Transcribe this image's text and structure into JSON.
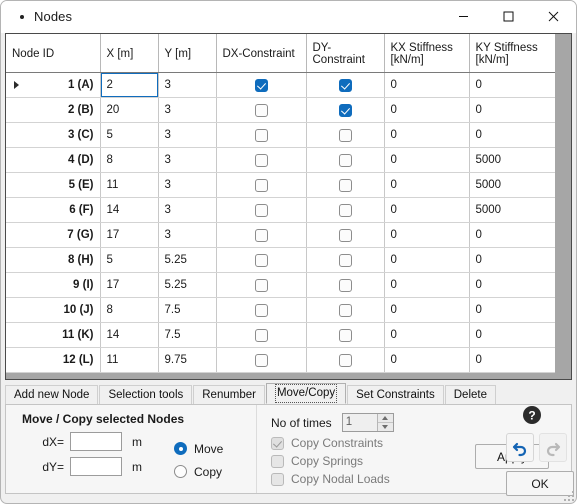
{
  "window": {
    "title": "Nodes",
    "icon": "bullet-icon",
    "controls": {
      "minimize": "minimize-icon",
      "maximize": "maximize-icon",
      "close": "close-icon"
    }
  },
  "grid": {
    "columns": [
      {
        "key": "id",
        "label": "Node ID"
      },
      {
        "key": "x",
        "label": "X [m]"
      },
      {
        "key": "y",
        "label": "Y [m]"
      },
      {
        "key": "dx",
        "label": "DX-Constraint"
      },
      {
        "key": "dy",
        "label": "DY-Constraint"
      },
      {
        "key": "kx",
        "label": "KX Stiffness\n[kN/m]",
        "line1": "KX Stiffness",
        "line2": "[kN/m]"
      },
      {
        "key": "ky",
        "label": "KY Stiffness\n[kN/m]",
        "line1": "KY Stiffness",
        "line2": "[kN/m]"
      }
    ],
    "selected_cell": {
      "row": 0,
      "column": "x"
    },
    "current_row_indicator": 0,
    "rows": [
      {
        "id": "1 (A)",
        "x": "2",
        "y": "3",
        "dx": true,
        "dy": true,
        "kx": "0",
        "ky": "0"
      },
      {
        "id": "2 (B)",
        "x": "20",
        "y": "3",
        "dx": false,
        "dy": true,
        "kx": "0",
        "ky": "0"
      },
      {
        "id": "3 (C)",
        "x": "5",
        "y": "3",
        "dx": false,
        "dy": false,
        "kx": "0",
        "ky": "0"
      },
      {
        "id": "4 (D)",
        "x": "8",
        "y": "3",
        "dx": false,
        "dy": false,
        "kx": "0",
        "ky": "5000"
      },
      {
        "id": "5 (E)",
        "x": "11",
        "y": "3",
        "dx": false,
        "dy": false,
        "kx": "0",
        "ky": "5000"
      },
      {
        "id": "6 (F)",
        "x": "14",
        "y": "3",
        "dx": false,
        "dy": false,
        "kx": "0",
        "ky": "5000"
      },
      {
        "id": "7 (G)",
        "x": "17",
        "y": "3",
        "dx": false,
        "dy": false,
        "kx": "0",
        "ky": "0"
      },
      {
        "id": "8 (H)",
        "x": "5",
        "y": "5.25",
        "dx": false,
        "dy": false,
        "kx": "0",
        "ky": "0"
      },
      {
        "id": "9 (I)",
        "x": "17",
        "y": "5.25",
        "dx": false,
        "dy": false,
        "kx": "0",
        "ky": "0"
      },
      {
        "id": "10 (J)",
        "x": "8",
        "y": "7.5",
        "dx": false,
        "dy": false,
        "kx": "0",
        "ky": "0"
      },
      {
        "id": "11 (K)",
        "x": "14",
        "y": "7.5",
        "dx": false,
        "dy": false,
        "kx": "0",
        "ky": "0"
      },
      {
        "id": "12 (L)",
        "x": "11",
        "y": "9.75",
        "dx": false,
        "dy": false,
        "kx": "0",
        "ky": "0"
      }
    ]
  },
  "tabs": {
    "active": "Move/Copy",
    "items": [
      {
        "label": "Add new Node"
      },
      {
        "label": "Selection tools"
      },
      {
        "label": "Renumber"
      },
      {
        "label": "Move/Copy"
      },
      {
        "label": "Set Constraints"
      },
      {
        "label": "Delete"
      }
    ]
  },
  "move_copy_panel": {
    "title": "Move / Copy selected Nodes",
    "dx_label": "dX=",
    "dx_value": "",
    "dx_unit": "m",
    "dy_label": "dY=",
    "dy_value": "",
    "dy_unit": "m",
    "mode_options": [
      {
        "label": "Move",
        "selected": true
      },
      {
        "label": "Copy",
        "selected": false
      }
    ],
    "times_label": "No of times",
    "times_value": "1",
    "copy_options": [
      {
        "label": "Copy Constraints",
        "checked": true,
        "disabled": true
      },
      {
        "label": "Copy Springs",
        "checked": false,
        "disabled": true
      },
      {
        "label": "Copy Nodal Loads",
        "checked": false,
        "disabled": true
      }
    ],
    "apply_label": "Apply"
  },
  "side_buttons": {
    "help": "help-icon",
    "undo": "undo-icon",
    "redo": "redo-icon",
    "ok_label": "OK"
  },
  "colors": {
    "accent": "#0f6cbd",
    "grid_background": "#a6a6a6",
    "panel": "#f0f0f0"
  }
}
